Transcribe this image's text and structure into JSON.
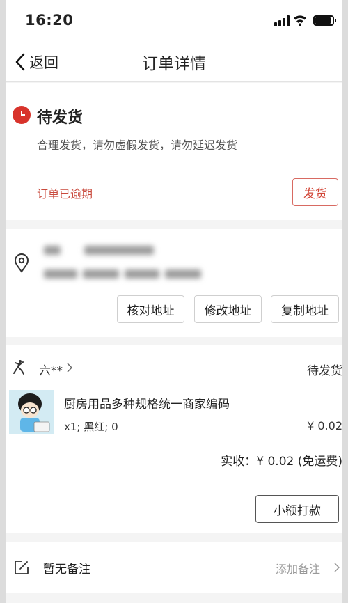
{
  "status_bar": {
    "time": "16:20"
  },
  "nav": {
    "back_label": "返回",
    "title": "订单详情"
  },
  "order_status": {
    "title": "待发货",
    "subtitle": "合理发货，请勿虚假发货，请勿延迟发货",
    "warning": "订单已逾期",
    "ship_button": "发货",
    "accent_color": "#d8332b"
  },
  "address": {
    "buttons": [
      "核对地址",
      "修改地址",
      "复制地址"
    ]
  },
  "order": {
    "buyer": "六**",
    "status": "待发货",
    "product_name": "厨房用品多种规格统一商家编码",
    "spec": "x1; 黑红; 0",
    "price": "¥ 0.02",
    "total": "实收：¥ 0.02 (免运费)",
    "refund_button": "小额打款"
  },
  "remark": {
    "text": "暂无备注",
    "action": "添加备注"
  },
  "icons": [
    "back-chevron-icon",
    "clock-icon",
    "location-pin-icon",
    "jordan-logo-icon",
    "chevron-right-icon",
    "edit-note-icon"
  ]
}
